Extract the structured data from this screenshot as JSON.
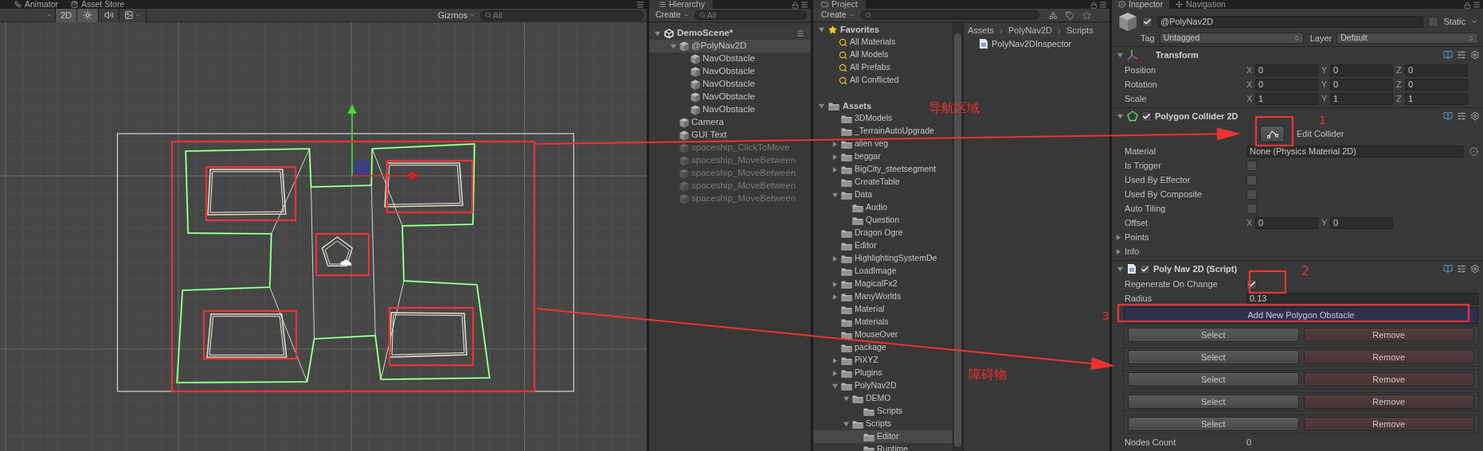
{
  "scene_view": {
    "tabs": [
      "Animator",
      "Asset Store"
    ],
    "toolbar": [
      {
        "kind": "text",
        "label": "2D",
        "on": true
      },
      {
        "kind": "lighting",
        "on": true
      },
      {
        "kind": "audio",
        "on": false
      },
      {
        "kind": "effects",
        "on": false
      }
    ],
    "gizmos": "Gizmos",
    "search_placeholder": "All"
  },
  "hierarchy": {
    "title": "Hierarchy",
    "create": "Create",
    "search_placeholder": "All",
    "scene": {
      "name": "DemoScene*",
      "expanded": true,
      "children": [
        {
          "name": "@PolyNav2D",
          "active": true,
          "selected": true,
          "expanded": true,
          "children": [
            {
              "name": "NavObstacle",
              "active": true,
              "selected": false
            },
            {
              "name": "NavObstacle",
              "active": true,
              "selected": false
            },
            {
              "name": "NavObstacle",
              "active": true,
              "selected": false
            },
            {
              "name": "NavObstacle",
              "active": true,
              "selected": false
            },
            {
              "name": "NavObstacle",
              "active": true,
              "selected": false
            }
          ]
        },
        {
          "name": "Camera",
          "active": true,
          "selected": false
        },
        {
          "name": "GUI Text",
          "active": true,
          "selected": false
        },
        {
          "name": "spaceship_ClickToMove",
          "active": false,
          "selected": false
        },
        {
          "name": "spaceship_MoveBetween",
          "active": false,
          "selected": false
        },
        {
          "name": "spaceship_MoveBetween",
          "active": false,
          "selected": false
        },
        {
          "name": "spaceship_MoveBetween",
          "active": false,
          "selected": false
        },
        {
          "name": "spaceship_MoveBetween",
          "active": false,
          "selected": false
        }
      ]
    }
  },
  "project": {
    "title": "Project",
    "create": "Create",
    "favorites": {
      "label": "Favorites",
      "expanded": true,
      "items": [
        "All Materials",
        "All Models",
        "All Prefabs",
        "All Conflicted"
      ]
    },
    "tree": {
      "name": "Assets",
      "expanded": true,
      "selected": false,
      "children": [
        {
          "name": "3DModels",
          "selected": false
        },
        {
          "name": "_TerrainAutoUpgrade",
          "selected": false
        },
        {
          "name": "alien veg",
          "expanded": false,
          "selected": false
        },
        {
          "name": "beggar",
          "expanded": false,
          "selected": false
        },
        {
          "name": "BigCity_steetsegment",
          "expanded": false,
          "selected": false
        },
        {
          "name": "CreateTable",
          "selected": false
        },
        {
          "name": "Data",
          "expanded": true,
          "selected": false,
          "children": [
            {
              "name": "Audio",
              "selected": false
            },
            {
              "name": "Question",
              "selected": false
            }
          ]
        },
        {
          "name": "Dragon Ogre",
          "selected": false
        },
        {
          "name": "Editor",
          "selected": false
        },
        {
          "name": "HighlightingSystemDe",
          "expanded": false,
          "selected": false
        },
        {
          "name": "LoadImage",
          "selected": false
        },
        {
          "name": "MagicalFx2",
          "expanded": false,
          "selected": false
        },
        {
          "name": "ManyWorlds",
          "expanded": false,
          "selected": false
        },
        {
          "name": "Material",
          "selected": false
        },
        {
          "name": "Materials",
          "selected": false
        },
        {
          "name": "MouseOver",
          "selected": false
        },
        {
          "name": "package",
          "selected": false
        },
        {
          "name": "PiXYZ",
          "expanded": false,
          "selected": false
        },
        {
          "name": "Plugins",
          "expanded": false,
          "selected": false
        },
        {
          "name": "PolyNav2D",
          "expanded": true,
          "selected": false,
          "children": [
            {
              "name": "DEMO",
              "expanded": true,
              "selected": false,
              "children": [
                {
                  "name": "Scripts",
                  "selected": false
                }
              ]
            },
            {
              "name": "Scripts",
              "expanded": true,
              "selected": false,
              "children": [
                {
                  "name": "Editor",
                  "selected": true
                },
                {
                  "name": "Runtime",
                  "selected": false
                }
              ]
            }
          ]
        }
      ]
    },
    "breadcrumb": [
      "Assets",
      "PolyNav2D",
      "Scripts"
    ],
    "files": [
      "PolyNav2DInspector"
    ]
  },
  "inspector": {
    "tabs": [
      {
        "label": "Inspector",
        "selected": true
      },
      {
        "label": "Navigation",
        "selected": false
      }
    ],
    "object": {
      "active": true,
      "name": "@PolyNav2D",
      "static_label": "Static",
      "static": false,
      "tag_label": "Tag",
      "tag": "Untagged",
      "layer_label": "Layer",
      "layer": "Default"
    },
    "components": [
      {
        "kind": "transform",
        "title": "Transform",
        "expanded": true,
        "rows": [
          {
            "kind": "vector",
            "label": "Position",
            "fields": [
              {
                "axis": "X",
                "value": "0"
              },
              {
                "axis": "Y",
                "value": "0"
              },
              {
                "axis": "Z",
                "value": "0"
              }
            ]
          },
          {
            "kind": "vector",
            "label": "Rotation",
            "fields": [
              {
                "axis": "X",
                "value": "0"
              },
              {
                "axis": "Y",
                "value": "0"
              },
              {
                "axis": "Z",
                "value": "0"
              }
            ]
          },
          {
            "kind": "vector",
            "label": "Scale",
            "fields": [
              {
                "axis": "X",
                "value": "1"
              },
              {
                "axis": "Y",
                "value": "1"
              },
              {
                "axis": "Z",
                "value": "1"
              }
            ]
          }
        ]
      },
      {
        "kind": "collider",
        "title": "Polygon Collider 2D",
        "expanded": true,
        "enabled": true,
        "rows": [
          {
            "kind": "edit",
            "label": "Edit Collider"
          },
          {
            "kind": "object",
            "label": "Material",
            "value": "None (Physics Material 2D)"
          },
          {
            "kind": "checkbox",
            "label": "Is Trigger",
            "checked": false
          },
          {
            "kind": "checkbox",
            "label": "Used By Effector",
            "checked": false
          },
          {
            "kind": "checkbox",
            "label": "Used By Composite",
            "checked": false
          },
          {
            "kind": "checkbox",
            "label": "Auto Tiling",
            "checked": false
          },
          {
            "kind": "vector",
            "label": "Offset",
            "fields": [
              {
                "axis": "X",
                "value": "0"
              },
              {
                "axis": "Y",
                "value": "0"
              }
            ]
          },
          {
            "kind": "foldout",
            "label": "Points",
            "expanded": false
          },
          {
            "kind": "foldout",
            "label": "Info",
            "expanded": false
          }
        ]
      },
      {
        "kind": "script",
        "title": "Poly Nav 2D (Script)",
        "expanded": true,
        "enabled": true,
        "rows": [
          {
            "kind": "checkbox",
            "label": "Regenerate On Change",
            "checked": true
          },
          {
            "kind": "text",
            "label": "Radius",
            "value": "0.13"
          },
          {
            "kind": "button",
            "label": "Add New Polygon Obstacle"
          },
          {
            "kind": "obstacle",
            "select": "Select",
            "remove": "Remove"
          },
          {
            "kind": "obstacle",
            "select": "Select",
            "remove": "Remove"
          },
          {
            "kind": "obstacle",
            "select": "Select",
            "remove": "Remove"
          },
          {
            "kind": "obstacle",
            "select": "Select",
            "remove": "Remove"
          },
          {
            "kind": "obstacle",
            "select": "Select",
            "remove": "Remove"
          },
          {
            "kind": "readout",
            "label": "Nodes Count",
            "value": "0"
          }
        ]
      }
    ]
  },
  "annotations": [
    {
      "text": "导航区域"
    },
    {
      "text": "障碍物"
    },
    {
      "text": "1"
    },
    {
      "text": "2"
    },
    {
      "text": "3"
    }
  ]
}
